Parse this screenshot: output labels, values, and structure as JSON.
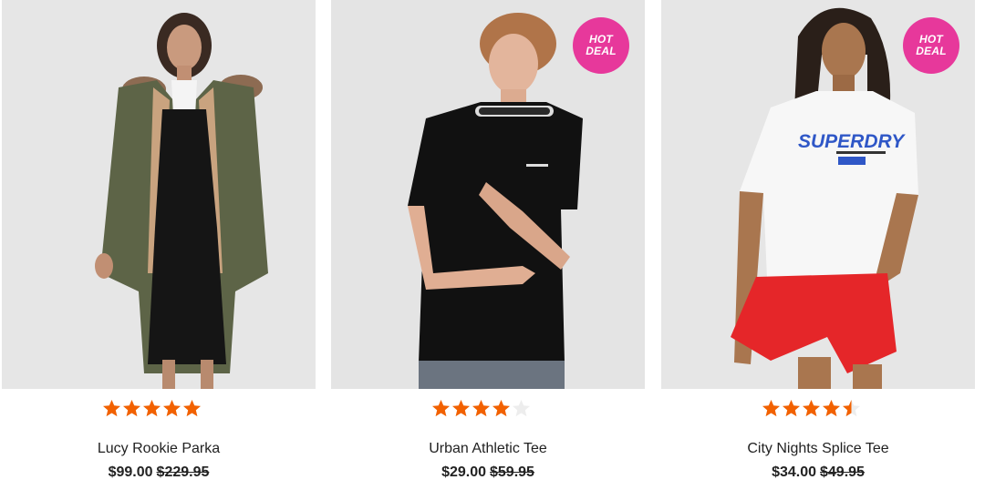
{
  "colors": {
    "badge": "#e7389b",
    "star_filled": "#f26100",
    "star_empty": "#ededed",
    "photo_bg": "#e4e4e4"
  },
  "products": [
    {
      "name": "Lucy Rookie Parka",
      "price": "$99.00",
      "was_price": "$229.95",
      "rating": 5,
      "badge": null,
      "image": "model wearing khaki fur-trim parka over black dress"
    },
    {
      "name": "Urban Athletic Tee",
      "price": "$29.00",
      "was_price": "$59.95",
      "rating": 4,
      "badge": {
        "line1": "HOT",
        "line2": "DEAL"
      },
      "image": "model wearing black tee with branded collar"
    },
    {
      "name": "City Nights Splice Tee",
      "price": "$34.00",
      "was_price": "$49.95",
      "rating": 4.5,
      "badge": {
        "line1": "HOT",
        "line2": "DEAL"
      },
      "image": "model wearing white Superdry graphic tee and red shorts",
      "graphic_text": "SUPERDRY"
    }
  ]
}
